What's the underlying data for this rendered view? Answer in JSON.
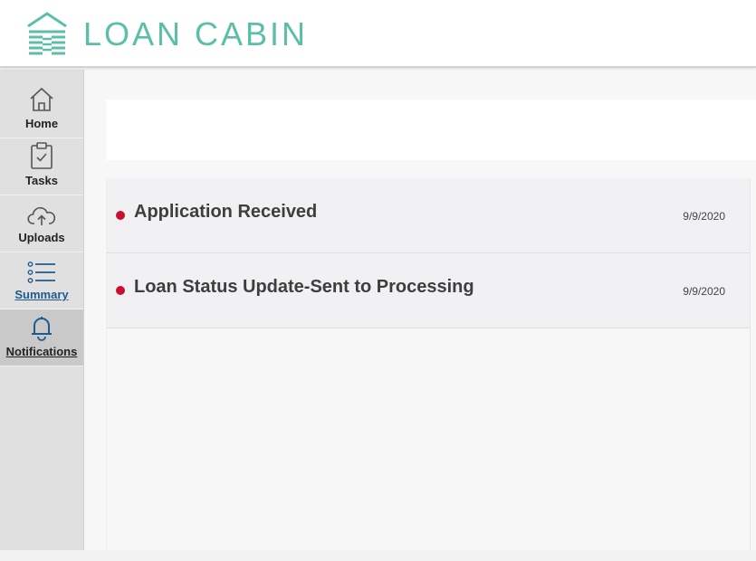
{
  "brand": {
    "name": "LOAN CABIN",
    "color": "#5bbfa8"
  },
  "sidebar": {
    "items": [
      {
        "label": "Home",
        "icon": "home-icon"
      },
      {
        "label": "Tasks",
        "icon": "clipboard-check-icon"
      },
      {
        "label": "Uploads",
        "icon": "cloud-upload-icon"
      },
      {
        "label": "Summary",
        "icon": "list-icon"
      },
      {
        "label": "Notifications",
        "icon": "bell-icon",
        "active": true
      }
    ]
  },
  "notifications": [
    {
      "title": "Application Received",
      "date": "9/9/2020",
      "status_color": "#c8102e"
    },
    {
      "title": "Loan Status Update-Sent to Processing",
      "date": "9/9/2020",
      "status_color": "#c8102e"
    }
  ]
}
